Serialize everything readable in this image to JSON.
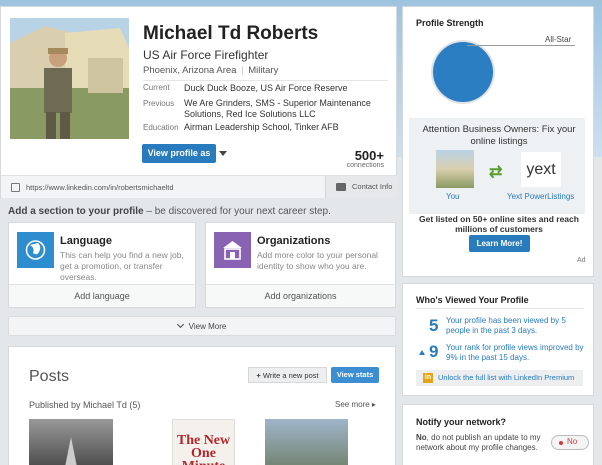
{
  "profile": {
    "name": "Michael Td Roberts",
    "headline": "US Air Force Firefighter",
    "location": "Phoenix, Arizona Area",
    "industry": "Military",
    "location_sep": "|",
    "current_label": "Current",
    "current_value": "Duck Duck Booze, US Air Force Reserve",
    "previous_label": "Previous",
    "previous_value": "We Are Grinders, SMS - Superior Maintenance Solutions, Red Ice Solutions LLC",
    "education_label": "Education",
    "education_value": "Airman Leadership School, Tinker AFB",
    "view_profile_label": "View profile as",
    "connections_count": "500+",
    "connections_label": "connections",
    "url": "https://www.linkedin.com/in/robertsmichaeltd",
    "contact_info_label": "Contact Info"
  },
  "add_section": {
    "title": "Add a section to your profile",
    "subtitle": " – be discovered for your next career step.",
    "cards": [
      {
        "title": "Language",
        "desc": "This can help you find a new job, get a promotion, or transfer overseas.",
        "action": "Add language"
      },
      {
        "title": "Organizations",
        "desc": "Add more color to your personal identity to show who you are.",
        "action": "Add organizations"
      }
    ],
    "view_more": "View More"
  },
  "posts": {
    "title": "Posts",
    "write_label": "Write a new post",
    "stats_label": "View stats",
    "published_by": "Published by Michael Td (5)",
    "see_more": "See more",
    "thumb2_text": "The New One Minute"
  },
  "strength": {
    "title": "Profile Strength",
    "level": "All-Star",
    "level_fraction": 1.0
  },
  "ad": {
    "headline": "Attention Business Owners: Fix your online listings",
    "you_label": "You",
    "yext_logo": "yext",
    "yext_label": "Yext PowerListings",
    "body": "Get listed on 50+ online sites and reach millions of customers",
    "cta": "Learn More!",
    "ad_label": "Ad"
  },
  "viewers": {
    "title": "Who's Viewed Your Profile",
    "views_count": "5",
    "views_text": "Your profile has been viewed by 5 people in the past 3 days.",
    "rank_count": "9",
    "rank_text": "Your rank for profile views improved by 9% in the past 15 days.",
    "unlock_label": "Unlock the full list with LinkedIn Premium",
    "premium_icon": "in"
  },
  "notify": {
    "title": "Notify your network?",
    "text_bold": "No",
    "text": ", do not publish an update to my network about my profile changes.",
    "toggle_label": "No"
  },
  "colors": {
    "accent": "#287bbc",
    "language_icon_bg": "#2e8dcf",
    "org_icon_bg": "#8a62b3",
    "strength_fill": "#2b7ec1",
    "arrow_green": "#5a9e2f",
    "toggle_red": "#d03b3b"
  }
}
